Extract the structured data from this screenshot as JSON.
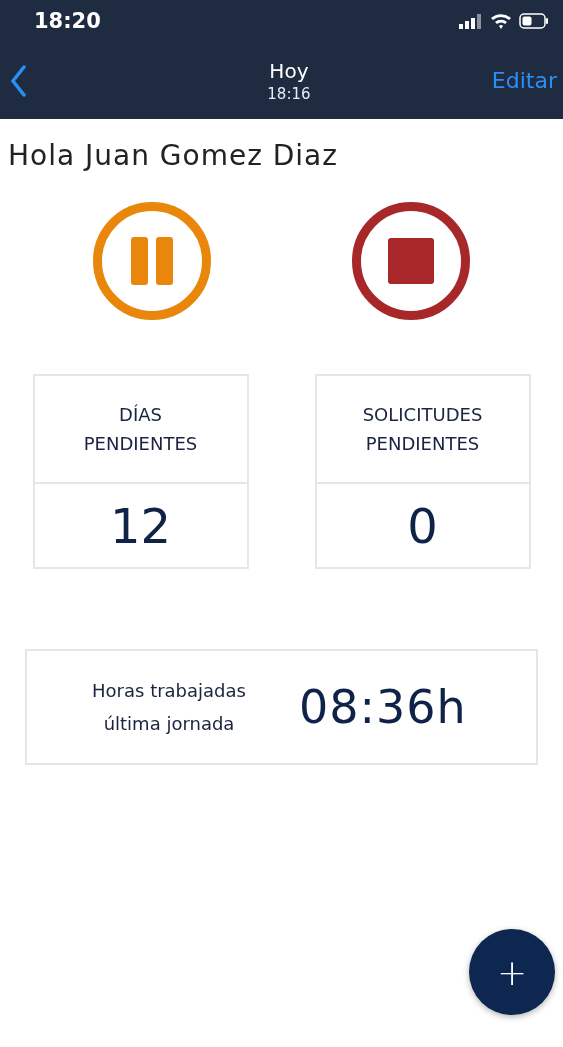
{
  "status_bar": {
    "time": "18:20"
  },
  "nav": {
    "title": "Hoy",
    "subtitle": "18:16",
    "action": "Editar"
  },
  "greeting": "Hola Juan Gomez Diaz",
  "controls": [
    {
      "kind": "pause",
      "color": "#e8870c"
    },
    {
      "kind": "stop",
      "color": "#a8282a"
    }
  ],
  "stats": [
    {
      "label": "DÍAS PENDIENTES",
      "value": "12"
    },
    {
      "label": "SOLICITUDES PENDIENTES",
      "value": "0"
    }
  ],
  "hours": {
    "label": "Horas trabajadas última jornada",
    "value": "08:36h"
  },
  "fab": {
    "symbol": "+"
  }
}
